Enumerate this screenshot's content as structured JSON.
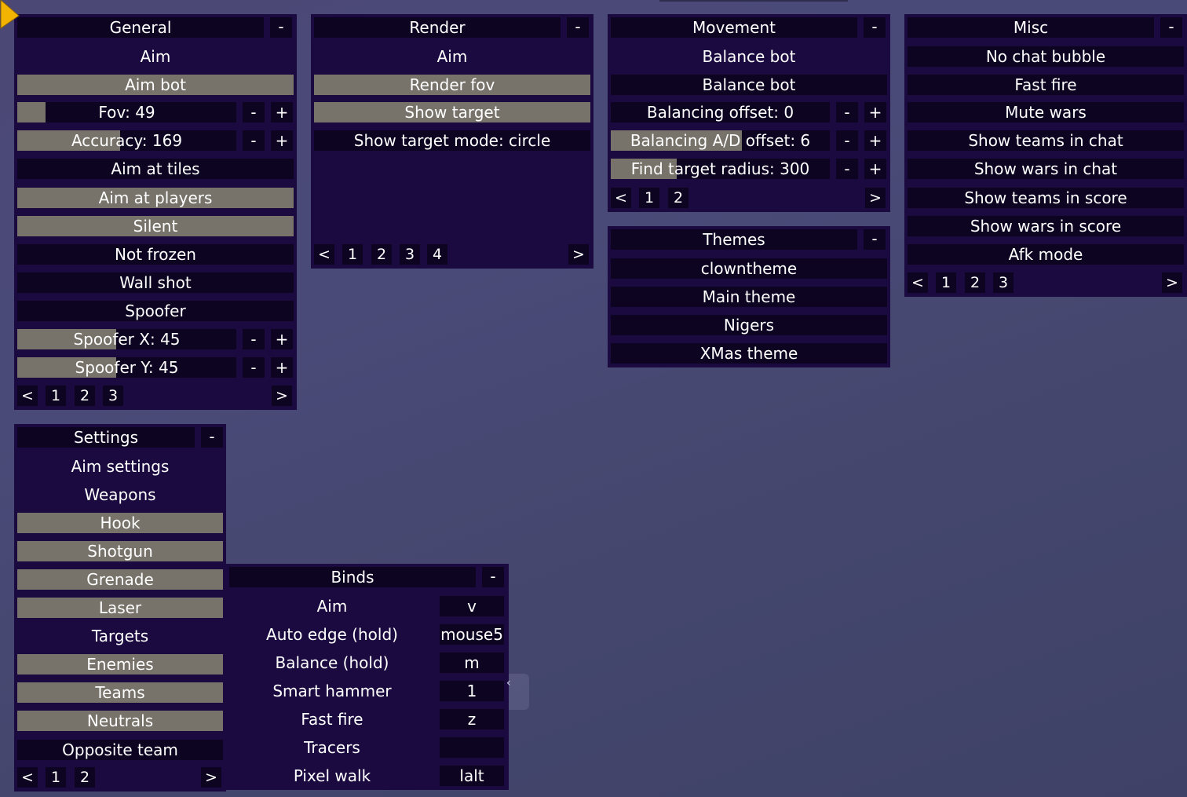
{
  "general": {
    "title": "General",
    "collapse": "-",
    "rows": {
      "aim_header": "Aim",
      "aim_bot": "Aim bot",
      "fov": "Fov: 49",
      "accuracy": "Accuracy: 169",
      "aim_at_tiles": "Aim at tiles",
      "aim_at_players": "Aim at players",
      "silent": "Silent",
      "not_frozen": "Not frozen",
      "wall_shot": "Wall shot",
      "spoofer": "Spoofer",
      "spoofer_x": "Spoofer X: 45",
      "spoofer_y": "Spoofer Y: 45"
    },
    "minus": "-",
    "plus": "+",
    "pager": {
      "prev": "<",
      "pages": [
        "1",
        "2",
        "3"
      ],
      "next": ">"
    }
  },
  "render": {
    "title": "Render",
    "collapse": "-",
    "rows": {
      "aim_header": "Aim",
      "render_fov": "Render fov",
      "show_target": "Show target",
      "show_target_mode": "Show target mode: circle"
    },
    "pager": {
      "prev": "<",
      "pages": [
        "1",
        "2",
        "3",
        "4"
      ],
      "next": ">"
    }
  },
  "movement": {
    "title": "Movement",
    "collapse": "-",
    "rows": {
      "balance_header": "Balance bot",
      "balance_bot": "Balance bot",
      "balancing_offset": "Balancing offset: 0",
      "balancing_ad_offset": "Balancing A/D offset: 6",
      "find_target_radius": "Find target radius: 300"
    },
    "minus": "-",
    "plus": "+",
    "pager": {
      "prev": "<",
      "pages": [
        "1",
        "2"
      ],
      "next": ">"
    }
  },
  "themes": {
    "title": "Themes",
    "collapse": "-",
    "items": [
      "clowntheme",
      "Main theme",
      "Nigers",
      "XMas theme"
    ]
  },
  "misc": {
    "title": "Misc",
    "collapse": "-",
    "items": [
      "No chat bubble",
      "Fast fire",
      "Mute wars",
      "Show teams in chat",
      "Show wars in chat",
      "Show teams in score",
      "Show wars in score",
      "Afk mode"
    ],
    "pager": {
      "prev": "<",
      "pages": [
        "1",
        "2",
        "3"
      ],
      "next": ">"
    }
  },
  "settings": {
    "title": "Settings",
    "collapse": "-",
    "rows": {
      "aim_settings": "Aim settings",
      "weapons": "Weapons",
      "hook": "Hook",
      "shotgun": "Shotgun",
      "grenade": "Grenade",
      "laser": "Laser",
      "targets": "Targets",
      "enemies": "Enemies",
      "teams": "Teams",
      "neutrals": "Neutrals",
      "opposite_team": "Opposite team"
    },
    "pager": {
      "prev": "<",
      "pages": [
        "1",
        "2"
      ],
      "next": ">"
    }
  },
  "binds": {
    "title": "Binds",
    "collapse": "-",
    "items": [
      {
        "label": "Aim",
        "key": "v"
      },
      {
        "label": "Auto edge (hold)",
        "key": "mouse5"
      },
      {
        "label": "Balance (hold)",
        "key": "m"
      },
      {
        "label": "Smart hammer",
        "key": "1"
      },
      {
        "label": "Fast fire",
        "key": "z"
      },
      {
        "label": "Tracers",
        "key": ""
      },
      {
        "label": "Pixel walk",
        "key": "lalt"
      }
    ]
  },
  "sliders": {
    "fov": 0.13,
    "accuracy": 0.47,
    "spoofer_x": 0.45,
    "spoofer_y": 0.45,
    "balancing_offset": 0.0,
    "balancing_ad_offset": 0.6,
    "find_target_radius": 0.3
  },
  "ghost_char": "‹",
  "colors": {
    "panel": "#1b0a40",
    "row_dark": "#0d0422",
    "row_on": "#77736a",
    "background": "#4a4a78",
    "cursor": "#f2b400"
  }
}
